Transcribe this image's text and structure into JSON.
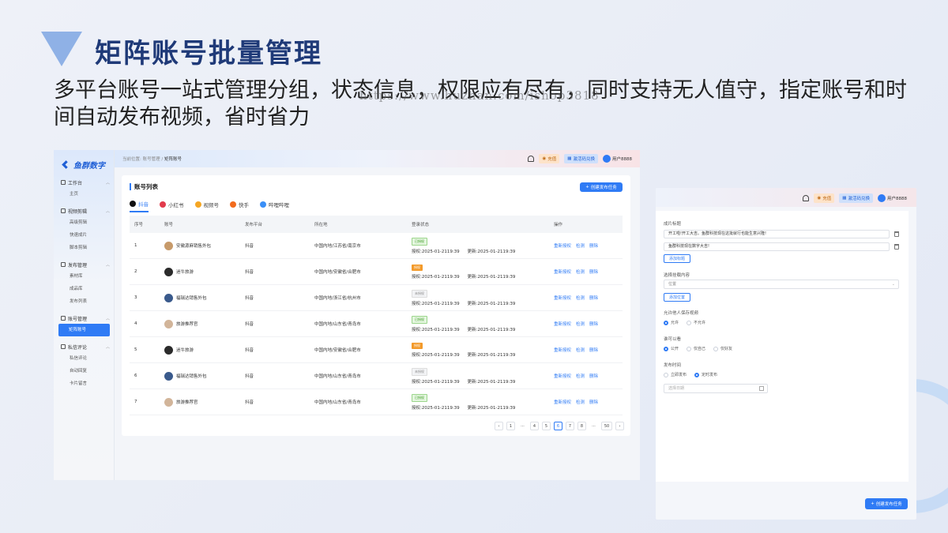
{
  "slide": {
    "title": "矩阵账号批量管理",
    "subtitle": "多平台账号一站式管理分组，状态信息，权限应有尽有，同时支持无人值守，指定账号和时间自动发布视频，省时省力",
    "watermark": "https://www.huzhan.com/ishop3818"
  },
  "app": {
    "logo_text": "鱼群数字",
    "breadcrumb": {
      "prefix": "当前位置:",
      "level1": "账号管理",
      "sep": "/",
      "current": "矩阵账号"
    },
    "topbar": {
      "recharge": "充值",
      "activate": "激活码兑换",
      "user": "用户8888"
    },
    "sidebar": [
      {
        "group": "工作台",
        "items": [
          "主页"
        ]
      },
      {
        "group": "视频剪辑",
        "items": [
          "高级剪辑",
          "快速成片",
          "脚本剪辑"
        ]
      },
      {
        "group": "发布管理",
        "items": [
          "素材库",
          "成品库",
          "发布列表"
        ]
      },
      {
        "group": "账号管理",
        "items": [
          "矩阵账号"
        ]
      },
      {
        "group": "私信评论",
        "items": [
          "私信评论",
          "自动回复",
          "卡片留言"
        ]
      }
    ]
  },
  "accounts": {
    "title": "账号列表",
    "create_button": "创建发布任务",
    "tabs": [
      {
        "label": "抖音",
        "color": "#111111"
      },
      {
        "label": "小红书",
        "color": "#e23b4c"
      },
      {
        "label": "视频号",
        "color": "#f5a623"
      },
      {
        "label": "快手",
        "color": "#f26b1d"
      },
      {
        "label": "哔哩哔哩",
        "color": "#3a8ff7"
      }
    ],
    "columns": [
      "序号",
      "账号",
      "发布平台",
      "所在地",
      "登录状态",
      "操作"
    ],
    "actions": [
      "重新授权",
      "检测",
      "删除"
    ],
    "rows": [
      {
        "no": "1",
        "name": "安徽源麻销售外包",
        "platform": "抖音",
        "location": "中国内地/江苏省/南京市",
        "status": "已授权",
        "status_color": "green",
        "auth": "授权:2025-01-2119:39",
        "update": "更新:2025-01-2119:39",
        "avatar": "#c79a6a"
      },
      {
        "no": "2",
        "name": "迷牛旅游",
        "platform": "抖音",
        "location": "中国内地/安徽省/合肥市",
        "status": "授权",
        "status_color": "orange",
        "auth": "授权:2025-01-2119:39",
        "update": "更新:2025-01-2119:39",
        "avatar": "#2b2b2b"
      },
      {
        "no": "3",
        "name": "福瑞达销售外包",
        "platform": "抖音",
        "location": "中国内地/浙江省/杭州市",
        "status": "未授权",
        "status_color": "gray",
        "auth": "授权:2025-01-2119:39",
        "update": "更新:2025-01-2119:39",
        "avatar": "#3a5a8c"
      },
      {
        "no": "4",
        "name": "旅游推荐官",
        "platform": "抖音",
        "location": "中国内地/山东省/青岛市",
        "status": "已授权",
        "status_color": "green",
        "auth": "授权:2025-01-2119:39",
        "update": "更新:2025-01-2119:39",
        "avatar": "#d2b59a"
      },
      {
        "no": "5",
        "name": "迷牛旅游",
        "platform": "抖音",
        "location": "中国内地/安徽省/合肥市",
        "status": "授权",
        "status_color": "orange",
        "auth": "授权:2025-01-2119:39",
        "update": "更新:2025-01-2119:39",
        "avatar": "#2b2b2b"
      },
      {
        "no": "6",
        "name": "福瑞达销售外包",
        "platform": "抖音",
        "location": "中国内地/山东省/青岛市",
        "status": "未授权",
        "status_color": "gray",
        "auth": "授权:2025-01-2119:39",
        "update": "更新:2025-01-2119:39",
        "avatar": "#3a5a8c"
      },
      {
        "no": "7",
        "name": "旅游推荐官",
        "platform": "抖音",
        "location": "中国内地/山东省/青岛市",
        "status": "已授权",
        "status_color": "green",
        "auth": "授权:2025-01-2119:39",
        "update": "更新:2025-01-2119:39",
        "avatar": "#d2b59a"
      }
    ],
    "pagination": {
      "pages": [
        "1",
        "···",
        "4",
        "5",
        "6",
        "7",
        "8",
        "···",
        "50"
      ],
      "current": "6"
    }
  },
  "publish_form": {
    "title_label": "成片标题",
    "titles": [
      "开工啦!开工大吉。鱼群科技现在这批就行也能生意兴隆!",
      "鱼群科技现在数字大吉!"
    ],
    "add_title": "添加标题",
    "content_label": "选择挂载内容",
    "content_value": "位置",
    "add_location": "添加位置",
    "save_label": "允许他人保存视频",
    "save_options": [
      "允许",
      "不允许"
    ],
    "visible_label": "谁可以看",
    "visible_options": [
      "公开",
      "仅自己",
      "仅好友"
    ],
    "time_label": "发布时间",
    "time_options": [
      "立即发布",
      "定时发布"
    ],
    "date_placeholder": "选择日期",
    "submit": "创建发布任务"
  }
}
